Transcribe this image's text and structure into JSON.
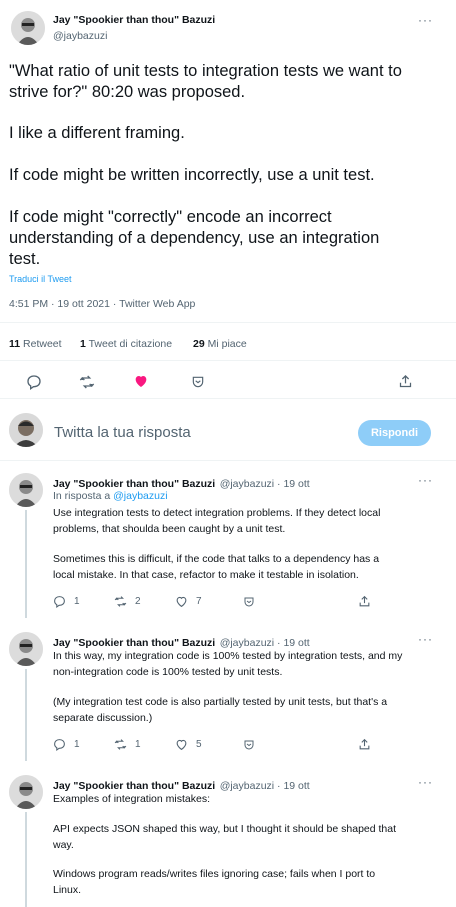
{
  "main_tweet": {
    "author_name": "Jay \"Spookier than thou\" Bazuzi",
    "author_handle": "@jaybazuzi",
    "more_glyph": "···",
    "lines": [
      "\"What ratio of unit tests to integration tests we want to",
      "strive for?\" 80:20 was proposed.",
      "I like a different framing.",
      "If code might be written incorrectly, use a unit test.",
      "If code might \"correctly\" encode an incorrect",
      "understanding of a dependency, use an integration",
      "test."
    ],
    "translate_link": "Traduci il Tweet",
    "timestamp": "4:51 PM · 19 ott 2021 · Twitter Web App",
    "stats": {
      "retweets_count": "11",
      "retweets_label": "Retweet",
      "quotes_count": "1",
      "quotes_label": "Tweet di citazione",
      "likes_count": "29",
      "likes_label": "Mi piace"
    },
    "like_color": "#f91880"
  },
  "compose": {
    "placeholder": "Twitta la tua risposta",
    "button_label": "Rispondi"
  },
  "replies": [
    {
      "author_name": "Jay \"Spookier than thou\" Bazuzi",
      "handle_time": "@jaybazuzi · 19 ott",
      "reply_to_prefix": "In risposta a ",
      "reply_to_handle": "@jaybazuzi",
      "lines": [
        "Use integration tests to detect integration problems. If they detect local",
        "problems, that shoulda been caught by a unit test.",
        "",
        "Sometimes this is difficult, if the code that talks to a dependency has a",
        "local mistake. In that case, refactor to make it testable in isolation."
      ],
      "reply_count": "1",
      "retweet_count": "2",
      "like_count": "7"
    },
    {
      "author_name": "Jay \"Spookier than thou\" Bazuzi",
      "handle_time": "@jaybazuzi · 19 ott",
      "lines": [
        "In this way, my integration code is 100% tested by integration tests, and my",
        "non-integration code is 100% tested by unit tests.",
        "",
        "(My integration test code is also partially tested by unit tests, but that's a",
        "separate discussion.)"
      ],
      "reply_count": "1",
      "retweet_count": "1",
      "like_count": "5"
    },
    {
      "author_name": "Jay \"Spookier than thou\" Bazuzi",
      "handle_time": "@jaybazuzi · 19 ott",
      "lines": [
        "Examples of integration mistakes:",
        "",
        "API expects JSON shaped this way, but I thought it should be shaped that",
        "way.",
        "",
        "Windows program reads/writes files ignoring case; fails when I port to",
        "Linux."
      ]
    }
  ]
}
